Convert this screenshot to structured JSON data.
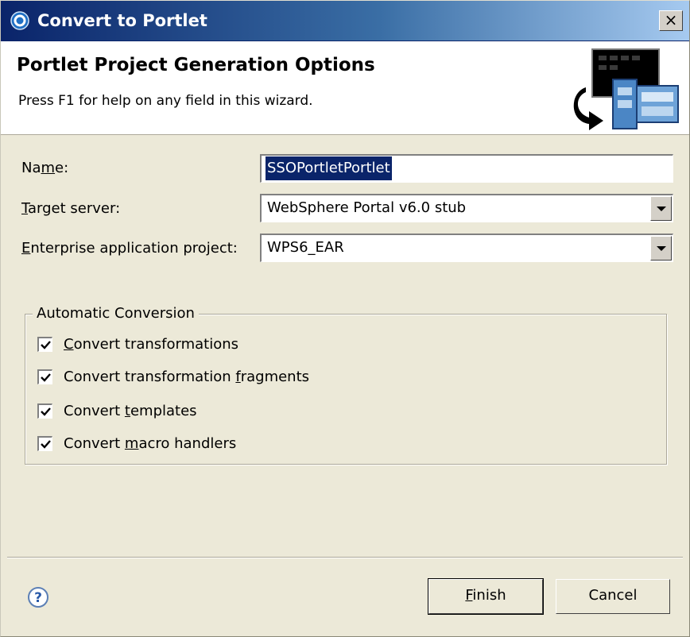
{
  "window": {
    "title": "Convert to Portlet",
    "close_label": "×"
  },
  "banner": {
    "title": "Portlet Project Generation Options",
    "description": "Press F1 for help on any field in this wizard."
  },
  "form": {
    "name": {
      "label_pre": "Na",
      "label_mnemonic": "m",
      "label_post": "e:",
      "value": "SSOPortletPortlet"
    },
    "target_server": {
      "label_mnemonic": "T",
      "label_post": "arget server:",
      "value": "WebSphere Portal v6.0 stub"
    },
    "ear_project": {
      "label_mnemonic": "E",
      "label_post": "nterprise application project:",
      "value": "WPS6_EAR"
    }
  },
  "conversion": {
    "legend": "Automatic Conversion",
    "options": [
      {
        "pre": "",
        "mnemonic": "C",
        "post": "onvert transformations",
        "checked": true
      },
      {
        "pre": "Convert transformation ",
        "mnemonic": "f",
        "post": "ragments",
        "checked": true
      },
      {
        "pre": "Convert ",
        "mnemonic": "t",
        "post": "emplates",
        "checked": true
      },
      {
        "pre": "Convert ",
        "mnemonic": "m",
        "post": "acro handlers",
        "checked": true
      }
    ]
  },
  "footer": {
    "finish": {
      "mnemonic": "F",
      "post": "inish"
    },
    "cancel_label": "Cancel"
  },
  "colors": {
    "title_gradient_start": "#0a246a",
    "title_gradient_end": "#a6caf0",
    "dialog_face": "#ece9d8",
    "selection": "#0a246a"
  },
  "icons": [
    "wizard-banner-graphic",
    "help-icon",
    "close-icon",
    "dropdown-arrow-icon",
    "checkmark-icon"
  ]
}
